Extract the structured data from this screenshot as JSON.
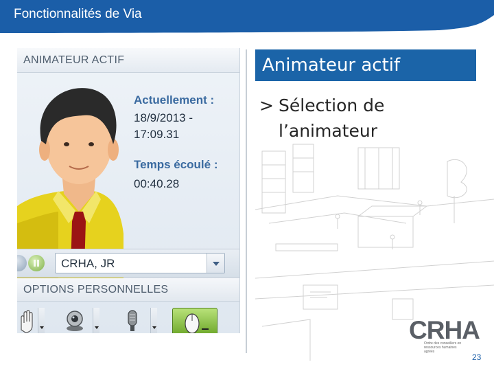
{
  "header": {
    "title": "Fonctionnalités de Via"
  },
  "panel": {
    "section_title": "ANIMATEUR ACTIF",
    "current_label": "Actuellement :",
    "current_value_line1": "18/9/2013 -",
    "current_value_line2": "17:09.31",
    "elapsed_label": "Temps écoulé :",
    "elapsed_value": "00:40.28",
    "presenter_select_value": "CRHA, JR",
    "options_title": "OPTIONS PERSONNELLES"
  },
  "slide": {
    "subtitle": "Animateur actif",
    "bullet_mark": ">",
    "bullet_line1": "Sélection de",
    "bullet_line2": "l’animateur",
    "page_number": "23"
  },
  "logo": {
    "name": "CRHA",
    "tagline": "Ordre des conseillers en ressources humaines agréés"
  },
  "colors": {
    "accent": "#1b64a8",
    "header_band": "#1b5ea8"
  }
}
